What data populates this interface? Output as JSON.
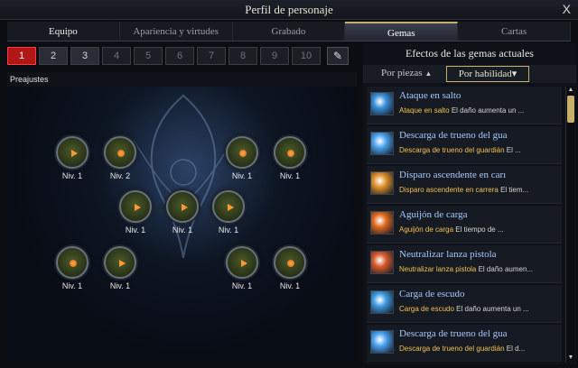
{
  "window": {
    "title": "Perfil de personaje",
    "close_glyph": "X"
  },
  "tabs": [
    {
      "label": "Equipo"
    },
    {
      "label": "Apariencia y virtudes"
    },
    {
      "label": "Grabado"
    },
    {
      "label": "Gemas"
    },
    {
      "label": "Cartas"
    }
  ],
  "presets": {
    "numbers": [
      "1",
      "2",
      "3",
      "4",
      "5",
      "6",
      "7",
      "8",
      "9",
      "10"
    ],
    "selected": "1",
    "label": "Preajustes",
    "edit_icon": "edit-icon"
  },
  "gems": {
    "levels": [
      "Niv. 1",
      "Niv. 2",
      "Niv. 1",
      "Niv. 1",
      "Niv. 1",
      "Niv. 1",
      "Niv. 1",
      "Niv. 1",
      "Niv. 1",
      "Niv. 1",
      "Niv. 1"
    ]
  },
  "right_panel": {
    "title": "Efectos de las gemas actuales",
    "sort_pieces": "Por piezas",
    "sort_skill": "Por habilidad",
    "effects": [
      {
        "name": "Ataque en salto",
        "skill": "Ataque en salto",
        "text": " El daño aumenta un ...",
        "color": "#3a8fd8"
      },
      {
        "name": "Descarga de trueno del gua",
        "skill": "Descarga de trueno del guardián",
        "text": " El ...",
        "color": "#4aa3f0"
      },
      {
        "name": "Disparo ascendente en carı",
        "skill": "Disparo ascendente en carrera",
        "text": " El tiem...",
        "color": "#e0902a"
      },
      {
        "name": "Aguijón de carga",
        "skill": "Aguijón de carga",
        "text": " El tiempo de ...",
        "color": "#e06a1e"
      },
      {
        "name": "Neutralizar lanza pistola",
        "skill": "Neutralizar lanza pistola",
        "text": " El daño aumen...",
        "color": "#d85a2a"
      },
      {
        "name": "Carga de escudo",
        "skill": "Carga de escudo",
        "text": " El daño aumenta un ...",
        "color": "#3f9be0"
      },
      {
        "name": "Descarga de trueno del gua",
        "skill": "Descarga de trueno del guardián",
        "text": " El d...",
        "color": "#4aa3f0"
      }
    ]
  }
}
